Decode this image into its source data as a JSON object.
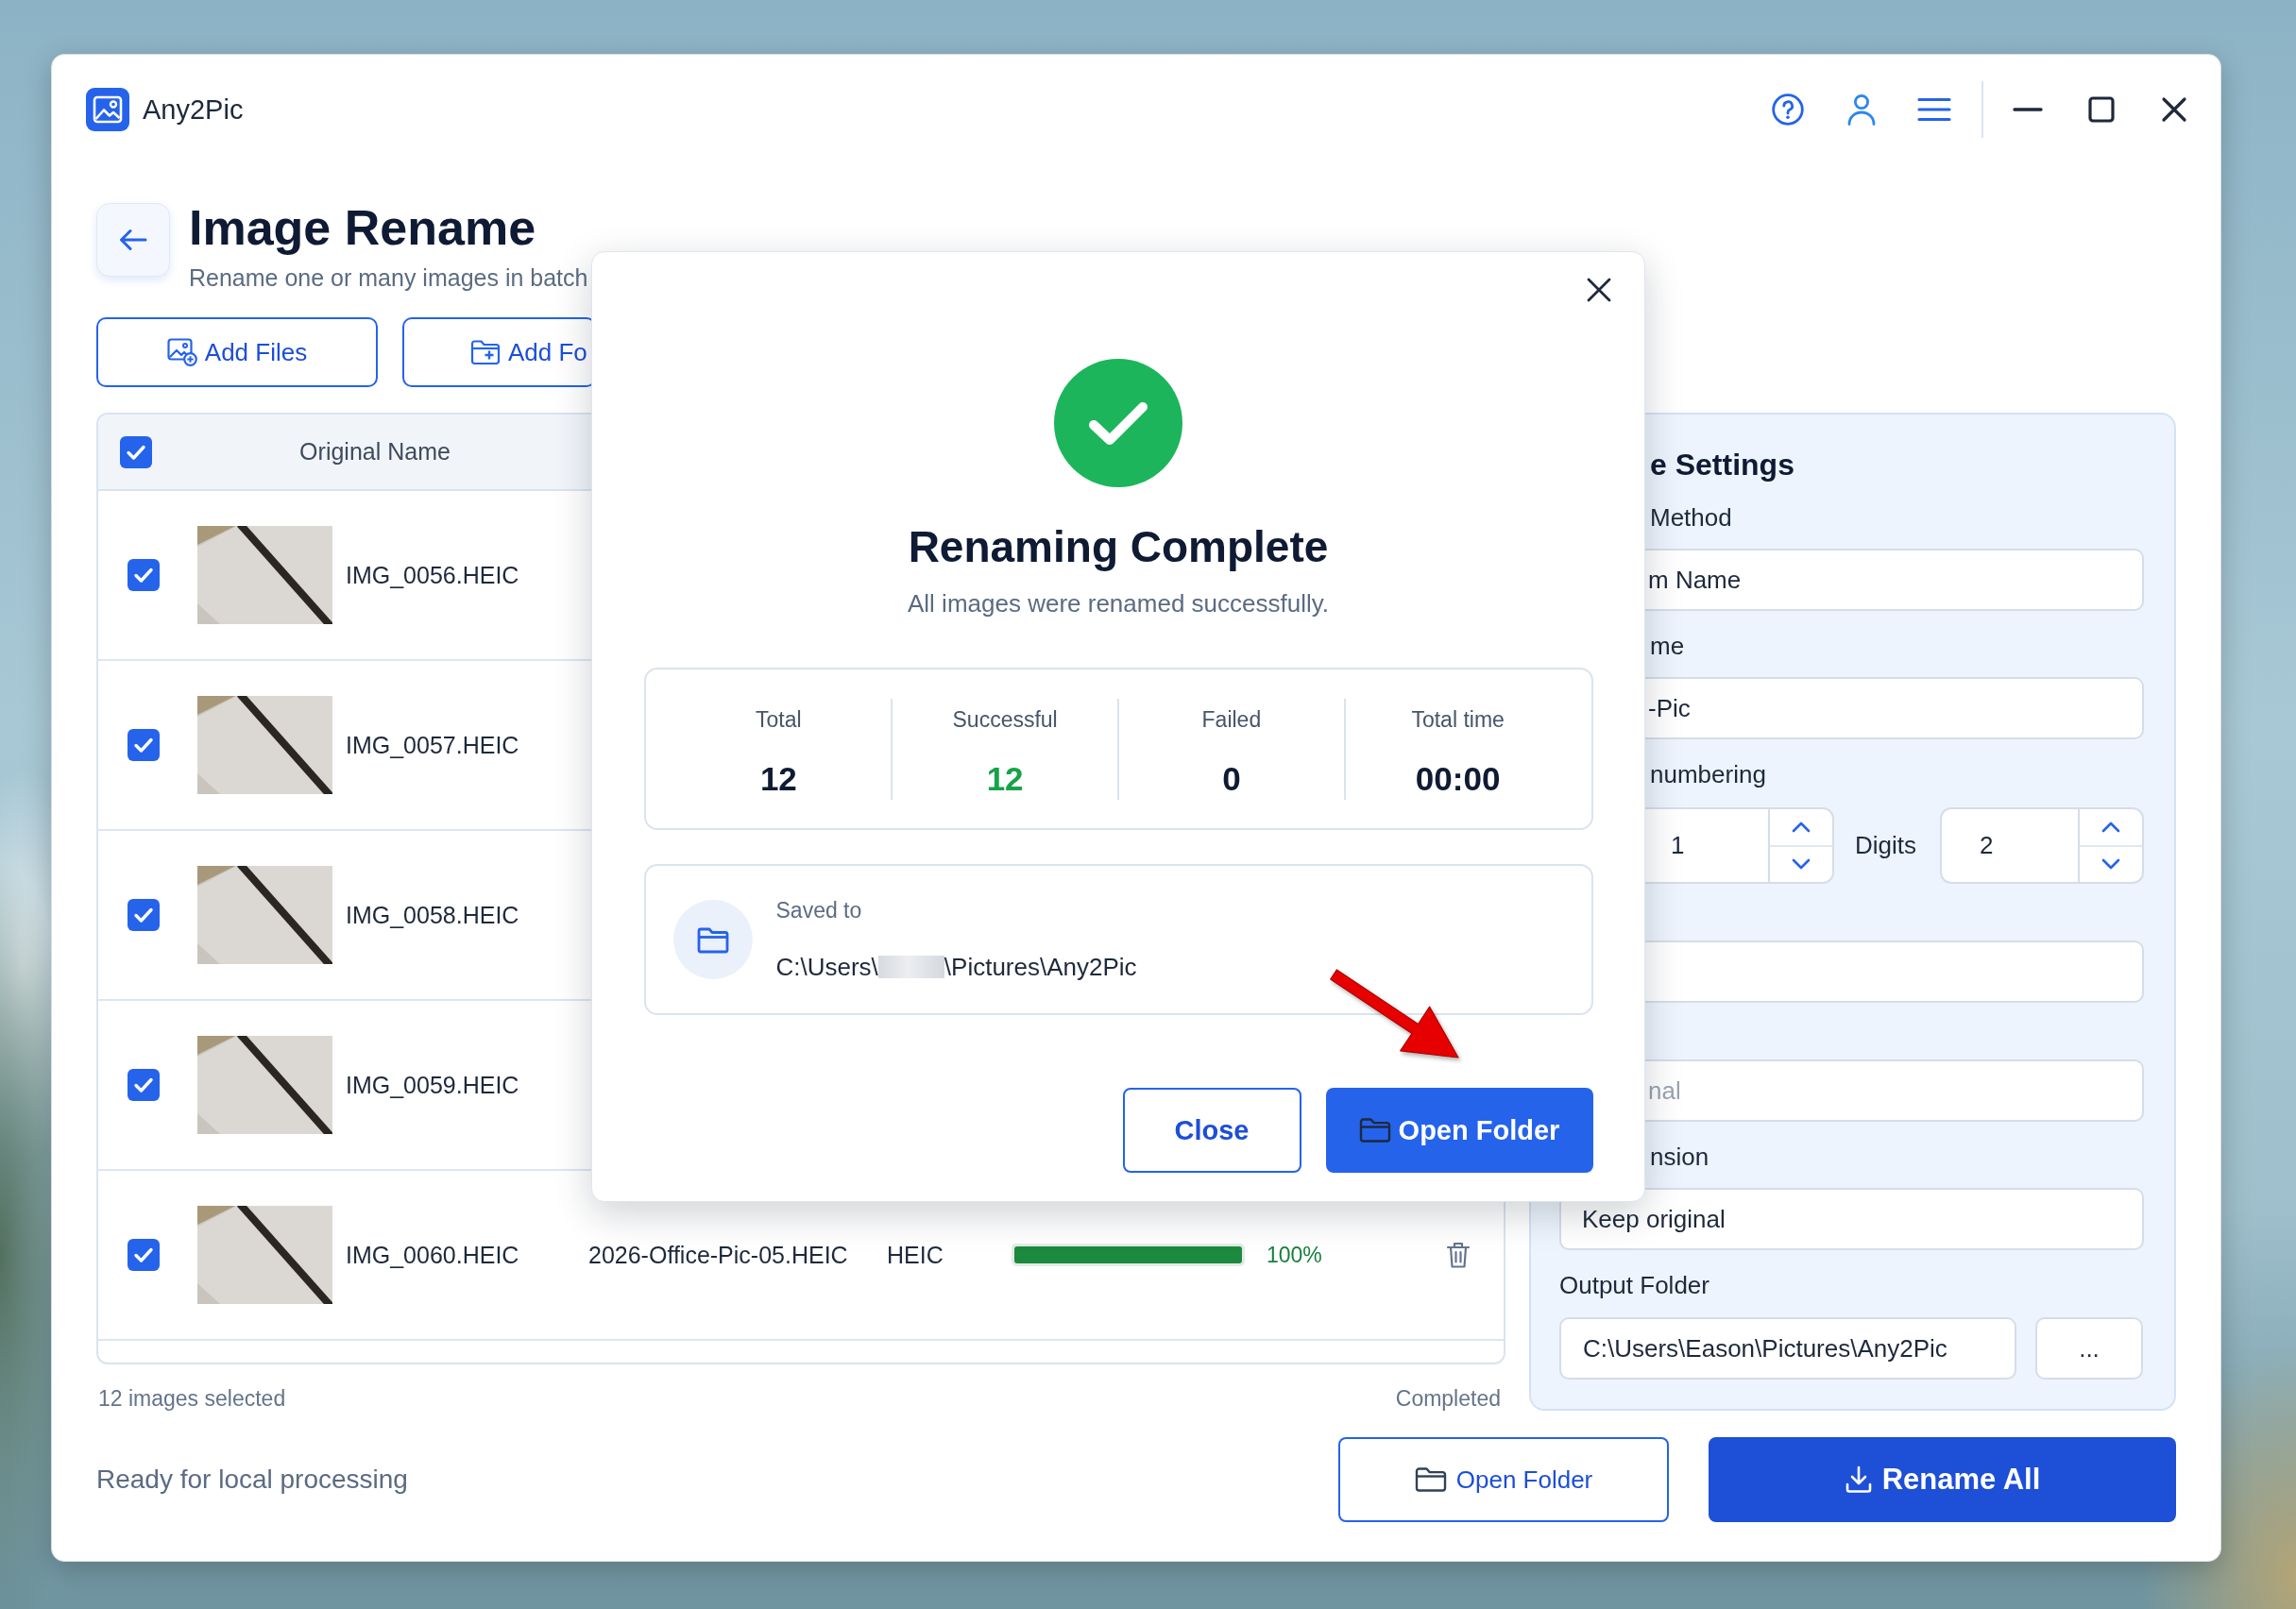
{
  "window": {
    "app_name": "Any2Pic"
  },
  "header": {
    "title": "Image Rename",
    "subtitle": "Rename one or many images in batch"
  },
  "toolbar": [
    {
      "kind": "files",
      "label": "Add Files"
    },
    {
      "kind": "folder",
      "label": "Add Fo"
    }
  ],
  "table": {
    "header_checked": true,
    "columns": [
      "Original Name"
    ],
    "rows": [
      {
        "checked": true,
        "original_name": "IMG_0056.HEIC"
      },
      {
        "checked": true,
        "original_name": "IMG_0057.HEIC"
      },
      {
        "checked": true,
        "original_name": "IMG_0058.HEIC"
      },
      {
        "checked": true,
        "original_name": "IMG_0059.HEIC"
      },
      {
        "checked": true,
        "original_name": "IMG_0060.HEIC",
        "new_name": "2026-Office-Pic-05.HEIC",
        "format": "HEIC",
        "level": 1,
        "progress": "100%"
      }
    ]
  },
  "table_footer": {
    "selection": "12 images selected",
    "status": "Completed"
  },
  "settings": {
    "items": [
      {
        "kind": "heading",
        "text": "e Settings"
      },
      {
        "kind": "label",
        "text": "Method"
      },
      {
        "kind": "field",
        "value": "m Name"
      },
      {
        "kind": "label",
        "text": "me"
      },
      {
        "kind": "field",
        "value": "-Pic"
      },
      {
        "kind": "label",
        "text": "numbering"
      },
      {
        "kind": "steppers",
        "start": "1",
        "digits_label": "Digits",
        "digits": "2"
      },
      {
        "kind": "field"
      },
      {
        "kind": "field",
        "placeholder": "nal"
      },
      {
        "kind": "label",
        "text": "nsion"
      },
      {
        "kind": "field",
        "value": "Keep original"
      },
      {
        "kind": "label",
        "text": "Output Folder"
      },
      {
        "kind": "folder_field",
        "value": "C:\\Users\\Eason\\Pictures\\Any2Pic",
        "button": "..."
      }
    ]
  },
  "status_bar": {
    "text": "Ready for local processing",
    "buttons": [
      {
        "kind": "secondary",
        "label": "Open Folder"
      },
      {
        "kind": "primary",
        "label": "Rename All"
      }
    ]
  },
  "dialog": {
    "title": "Renaming Complete",
    "message": "All images were renamed successfully.",
    "stats": [
      {
        "kind": "plain",
        "label": "Total",
        "value": "12"
      },
      {
        "kind": "success",
        "label": "Successful",
        "value": "12"
      },
      {
        "kind": "plain",
        "label": "Failed",
        "value": "0"
      },
      {
        "kind": "plain",
        "label": "Total time",
        "value": "00:00"
      }
    ],
    "saved_to": {
      "label": "Saved to",
      "path": [
        {
          "kind": "text",
          "text": "C:\\Users\\"
        },
        {
          "kind": "redacted"
        },
        {
          "kind": "text",
          "text": "\\Pictures\\Any2Pic"
        }
      ]
    },
    "buttons": [
      {
        "kind": "secondary",
        "label": "Close"
      },
      {
        "kind": "primary",
        "label": "Open Folder"
      }
    ]
  }
}
